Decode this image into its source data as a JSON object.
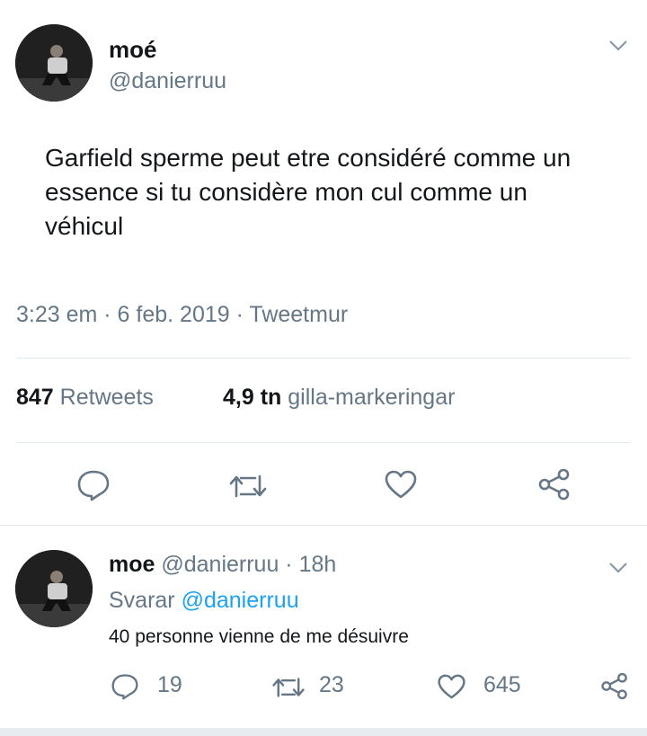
{
  "tweet": {
    "display_name": "moé",
    "handle": "@danierruu",
    "text": "Garfield sperme peut etre considéré comme un essence si tu considère mon cul comme un véhicul",
    "meta": "3:23 em · 6 feb. 2019 · Tweetmur",
    "retweet_count": "847",
    "retweet_label": "Retweets",
    "like_count": "4,9 tn",
    "like_label": "gilla-markeringar"
  },
  "reply": {
    "display_name": "moe",
    "handle_time": "@danierruu · 18h",
    "replying_prefix": "Svarar",
    "replying_to": "@danierruu",
    "text": "40 personne vienne de me désuivre",
    "reply_count": "19",
    "retweet_count": "23",
    "like_count": "645"
  },
  "icons": [
    "chevron-down-icon",
    "reply-icon",
    "retweet-icon",
    "like-icon",
    "share-icon"
  ],
  "colors": {
    "text": "#14171a",
    "secondary": "#657786",
    "link": "#1da1f2",
    "divider": "#e1e8ed"
  }
}
